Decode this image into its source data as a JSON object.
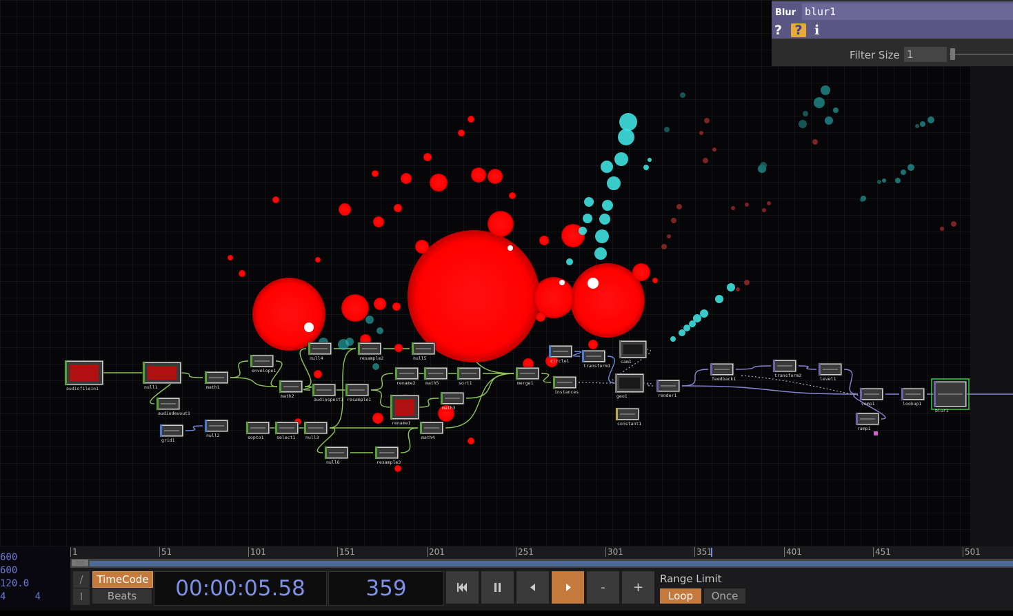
{
  "param_panel": {
    "op_type": "Blur",
    "op_name": "blur1",
    "help_label": "?",
    "python_help_label": "?",
    "info_label": "i",
    "filter_label": "Filter Size",
    "filter_value": "1"
  },
  "nodes": [
    {
      "name": "audiofilein1",
      "color": "green"
    },
    {
      "name": "null1",
      "color": "green"
    },
    {
      "name": "audiodevout1",
      "color": "green"
    },
    {
      "name": "math1",
      "color": "green"
    },
    {
      "name": "envelope1",
      "color": "green"
    },
    {
      "name": "math2",
      "color": "green"
    },
    {
      "name": "null4",
      "color": "green"
    },
    {
      "name": "resample2",
      "color": "green"
    },
    {
      "name": "null5",
      "color": "green"
    },
    {
      "name": "audiospect1",
      "color": "green"
    },
    {
      "name": "resample1",
      "color": "green"
    },
    {
      "name": "rename1",
      "color": "green"
    },
    {
      "name": "math5",
      "color": "green"
    },
    {
      "name": "sort1",
      "color": "green"
    },
    {
      "name": "rename2",
      "color": "green"
    },
    {
      "name": "math3",
      "color": "green"
    },
    {
      "name": "grid1",
      "color": "blue"
    },
    {
      "name": "null2",
      "color": "blue"
    },
    {
      "name": "sopto1",
      "color": "green"
    },
    {
      "name": "select1",
      "color": "green"
    },
    {
      "name": "null3",
      "color": "green"
    },
    {
      "name": "math4",
      "color": "green"
    },
    {
      "name": "null6",
      "color": "green"
    },
    {
      "name": "resample3",
      "color": "green"
    },
    {
      "name": "merge1",
      "color": "green"
    },
    {
      "name": "instances",
      "color": "green"
    },
    {
      "name": "circle1",
      "color": "blue"
    },
    {
      "name": "transform1",
      "color": "blue"
    },
    {
      "name": "cam1",
      "color": "gray"
    },
    {
      "name": "geo1",
      "color": "gray"
    },
    {
      "name": "constant1",
      "color": "yellow"
    },
    {
      "name": "render1",
      "color": "purple"
    },
    {
      "name": "feedback1",
      "color": "purple"
    },
    {
      "name": "transform2",
      "color": "purple"
    },
    {
      "name": "level1",
      "color": "purple"
    },
    {
      "name": "comp1",
      "color": "purple"
    },
    {
      "name": "lookup1",
      "color": "purple"
    },
    {
      "name": "blur1",
      "color": "purple"
    },
    {
      "name": "ramp1",
      "color": "purple"
    }
  ],
  "timeline": {
    "info": [
      "600",
      "600",
      "120.0",
      "4     4"
    ],
    "ruler_ticks": [
      "1",
      "51",
      "101",
      "151",
      "201",
      "251",
      "301",
      "351",
      "401",
      "451",
      "501"
    ],
    "side_top": "/",
    "side_bottom": "I",
    "timecode_label": "TimeCode",
    "beats_label": "Beats",
    "timecode": "00:00:05.58",
    "frame": "359",
    "range_label": "Range Limit",
    "loop_label": "Loop",
    "once_label": "Once",
    "minus_label": "-",
    "plus_label": "+"
  },
  "colors": {
    "accent": "#c47a3c",
    "header": "#5b5784",
    "particle_red": "#ff0000",
    "particle_cyan": "#3fe0e0"
  }
}
